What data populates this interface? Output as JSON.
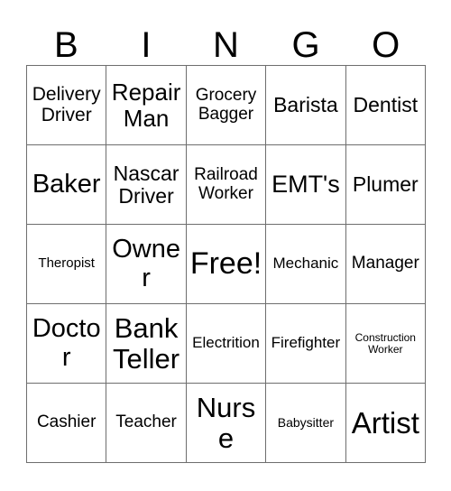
{
  "card": {
    "title": "Bingo Card",
    "header_letters": [
      "B",
      "I",
      "N",
      "G",
      "O"
    ],
    "columns": 5,
    "rows": 5,
    "border_color": "#6e6e6e",
    "text_color": "#000000",
    "background_color": "#ffffff",
    "free_space": {
      "row": 2,
      "col": 2,
      "label": "Free!"
    }
  },
  "grid": {
    "rows": [
      {
        "cells": [
          {
            "text": "Delivery Driver",
            "size": "sz-lg"
          },
          {
            "text": "Repair Man",
            "size": "sz-xl"
          },
          {
            "text": "Grocery Bagger",
            "size": "sz-md2"
          },
          {
            "text": "Barista",
            "size": "sz-lg2"
          },
          {
            "text": "Dentist",
            "size": "sz-lg2"
          }
        ]
      },
      {
        "cells": [
          {
            "text": "Baker",
            "size": "sz-2xl"
          },
          {
            "text": "Nascar Driver",
            "size": "sz-lg2"
          },
          {
            "text": "Railroad Worker",
            "size": "sz-md2"
          },
          {
            "text": "EMT's",
            "size": "sz-xl2"
          },
          {
            "text": "Plumer",
            "size": "sz-lg2"
          }
        ]
      },
      {
        "cells": [
          {
            "text": "Theropist",
            "size": "sz-sm2"
          },
          {
            "text": "Owner",
            "size": "sz-2xl"
          },
          {
            "text": "Free!",
            "size": "sz-5xl"
          },
          {
            "text": "Mechanic",
            "size": "sz-md"
          },
          {
            "text": "Manager",
            "size": "sz-md2"
          }
        ]
      },
      {
        "cells": [
          {
            "text": "Doctor",
            "size": "sz-2xl"
          },
          {
            "text": "Bank Teller",
            "size": "sz-3xl"
          },
          {
            "text": "Electrition",
            "size": "sz-md"
          },
          {
            "text": "Firefighter",
            "size": "sz-md"
          },
          {
            "text": "Construction Worker",
            "size": "sz-xs"
          }
        ]
      },
      {
        "cells": [
          {
            "text": "Cashier",
            "size": "sz-md2"
          },
          {
            "text": "Teacher",
            "size": "sz-md2"
          },
          {
            "text": "Nurse",
            "size": "sz-3xl"
          },
          {
            "text": "Babysitter",
            "size": "sz-sm"
          },
          {
            "text": "Artist",
            "size": "sz-4xl"
          }
        ]
      }
    ]
  }
}
